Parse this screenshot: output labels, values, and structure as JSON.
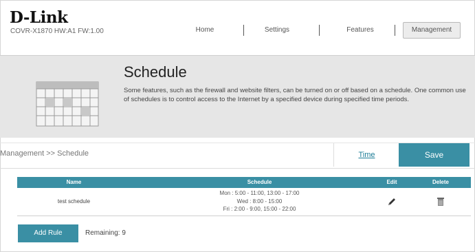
{
  "header": {
    "logo": "D-Link",
    "model": "COVR-X1870 HW:A1 FW:1.00",
    "nav": [
      {
        "label": "Home"
      },
      {
        "label": "Settings"
      },
      {
        "label": "Features"
      },
      {
        "label": "Management",
        "active": true
      }
    ]
  },
  "banner": {
    "title": "Schedule",
    "description": "Some features, such as the firewall and website filters, can be turned on or off based on a schedule. One common use of schedules is to control access to the Internet by a specified device during specified time periods."
  },
  "toolbar": {
    "breadcrumb": "Management >> Schedule",
    "time_link": "Time",
    "save_label": "Save"
  },
  "table": {
    "headers": [
      "Name",
      "Schedule",
      "Edit",
      "Delete"
    ],
    "rows": [
      {
        "name": "test schedule",
        "schedule": [
          "Mon : 5:00 - 11:00, 13:00 - 17:00",
          "Wed : 8:00 - 15:00",
          "Fri : 2:00 - 9:00, 15:00 - 22:00"
        ],
        "edit_icon": "pencil-icon",
        "delete_icon": "trash-icon"
      }
    ]
  },
  "footer": {
    "add_rule_label": "Add Rule",
    "remaining": "Remaining: 9"
  },
  "colors": {
    "accent": "#3a8fa4",
    "link": "#1b7c96",
    "banner_bg": "#e6e6e6"
  }
}
